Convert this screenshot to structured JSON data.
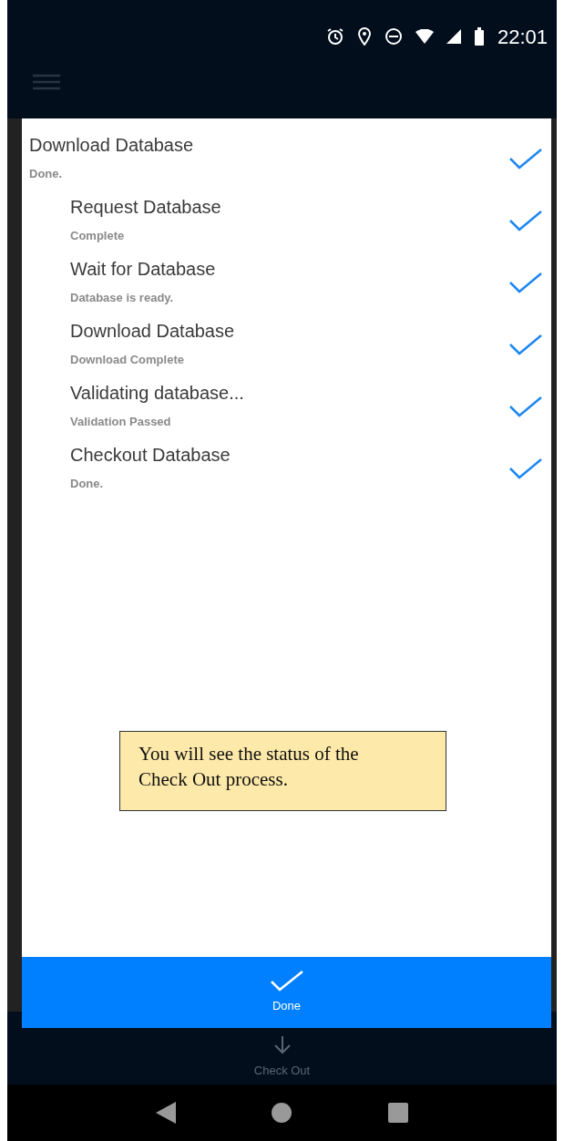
{
  "status_bar": {
    "time": "22:01"
  },
  "steps": [
    {
      "title": "Download Database",
      "status": "Done.",
      "checked": true,
      "children": [
        {
          "title": "Request Database",
          "status": "Complete",
          "checked": true
        },
        {
          "title": "Wait for Database",
          "status": "Database is ready.",
          "checked": true
        },
        {
          "title": "Download Database",
          "status": "Download Complete",
          "checked": true
        },
        {
          "title": "Validating database...",
          "status": "Validation Passed",
          "checked": true
        },
        {
          "title": "Checkout Database",
          "status": "Done.",
          "checked": true
        }
      ]
    }
  ],
  "callout": {
    "text": "You will see the status of the Check Out process."
  },
  "done_button": {
    "label": "Done"
  },
  "background_action": {
    "label": "Check Out"
  }
}
